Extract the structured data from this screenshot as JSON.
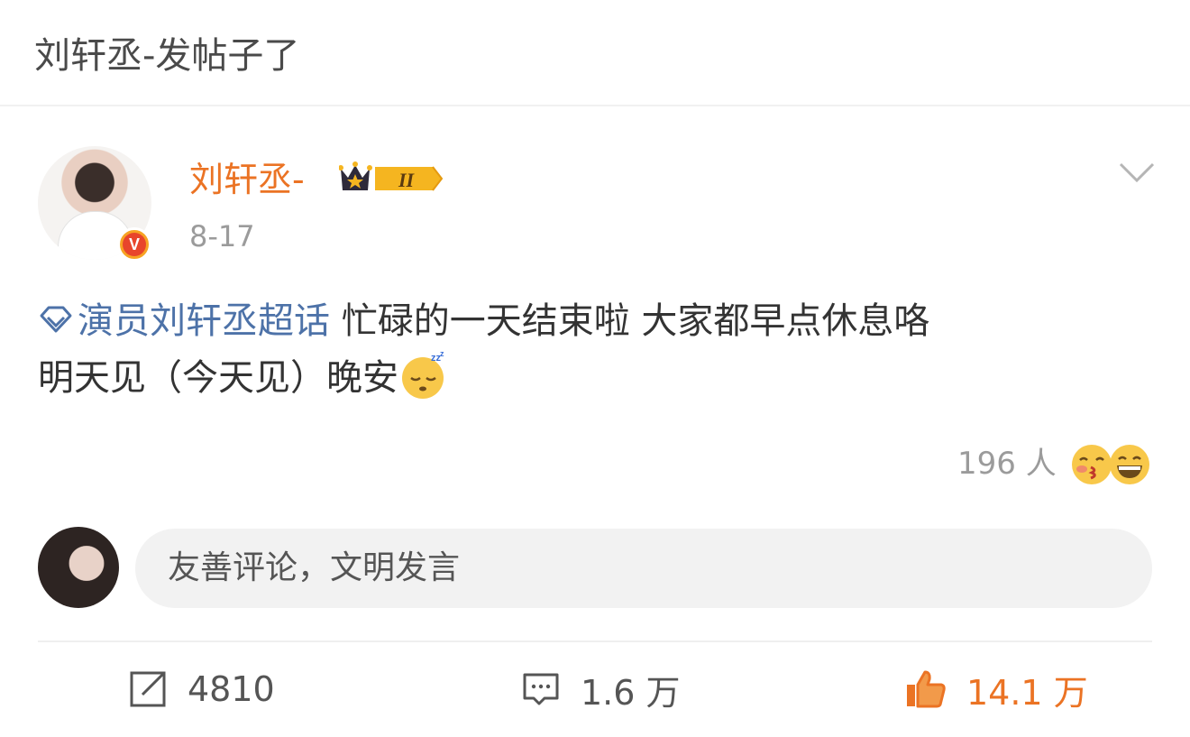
{
  "header": {
    "title": "刘轩丞-发帖子了"
  },
  "post": {
    "author": {
      "name": "刘轩丞-",
      "badge_text": "II"
    },
    "date": "8-17",
    "topic": "演员刘轩丞超话",
    "text_line1": "忙碌的一天结束啦 大家都早点休息咯",
    "text_line2": "明天见（今天见）晚安",
    "emoji": "sleeping-face-icon",
    "reactions": {
      "count_text": "196 人"
    }
  },
  "comment_box": {
    "placeholder": "友善评论，文明发言"
  },
  "actions": {
    "repost_count": "4810",
    "comment_count": "1.6 万",
    "like_count": "14.1 万"
  },
  "colors": {
    "accent": "#eb7324",
    "topic": "#4d72a8",
    "muted": "#9b9b9b"
  }
}
